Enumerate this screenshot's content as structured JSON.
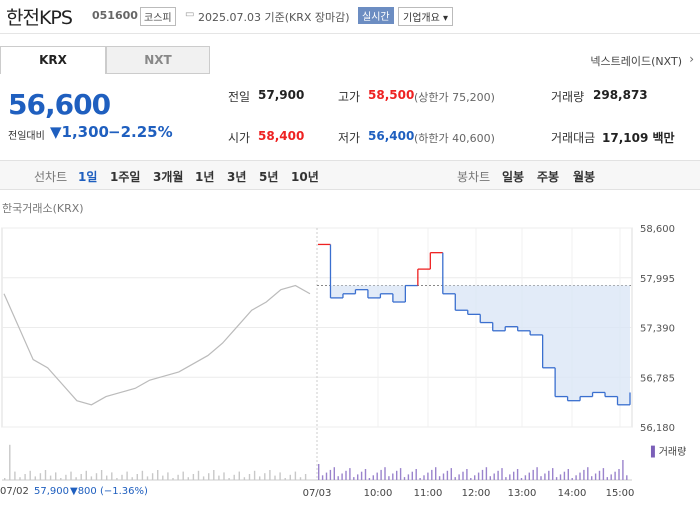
{
  "header": {
    "title": "한전KPS",
    "code": "051600",
    "market": "코스피",
    "date_text": "2025.07.03  기준(KRX 장마감)",
    "realtime_label": "실시간",
    "company_info_label": "기업개요 ▾"
  },
  "tabs": {
    "krx": "KRX",
    "nxt": "NXT",
    "nxt_link": "넥스트레이드(NXT)"
  },
  "quote": {
    "price": "56,600",
    "prev_label": "전일대비",
    "change": "▼1,300",
    "change_pct": "−2.25%",
    "prev_close_label": "전일",
    "prev_close": "57,900",
    "open_label": "시가",
    "open": "58,400",
    "high_label": "고가",
    "high": "58,500",
    "upper_limit": "(상한가 75,200)",
    "low_label": "저가",
    "low": "56,400",
    "lower_limit": "(하한가 40,600)",
    "volume_label": "거래량",
    "volume": "298,873",
    "amount_label": "거래대금",
    "amount": "17,109 백만"
  },
  "periods": {
    "line_label": "선차트",
    "items": [
      "1일",
      "1주일",
      "3개월",
      "1년",
      "3년",
      "5년",
      "10년"
    ],
    "candle_label": "봉차트",
    "candle_items": [
      "일봉",
      "주봉",
      "월봉"
    ]
  },
  "chart_source": "한국거래소(KRX)",
  "footer": {
    "prev_date": "07/02",
    "prev_price": "57,900",
    "prev_change": "▼800 (−1.36%)"
  },
  "volume_legend": "거래량",
  "chart_data": {
    "type": "line",
    "ylim": [
      56180,
      58600
    ],
    "y_ticks": [
      "58,600",
      "57,995",
      "57,390",
      "56,785",
      "56,180"
    ],
    "x_ticks": [
      "07/03",
      "10:00",
      "11:00",
      "12:00",
      "13:00",
      "14:00",
      "15:00"
    ],
    "reference_price": 57900,
    "series": [
      {
        "x": [
          "07/02",
          "",
          "",
          "",
          "",
          "",
          "",
          "",
          "",
          "",
          "",
          "",
          "",
          "",
          "",
          "",
          "",
          "",
          "",
          "",
          "",
          ""
        ],
        "values": [
          57800,
          57400,
          57000,
          56900,
          56700,
          56500,
          56450,
          56550,
          56600,
          56650,
          56750,
          56800,
          56850,
          56950,
          57050,
          57200,
          57400,
          57600,
          57700,
          57850,
          57900,
          57800
        ]
      },
      {
        "x": [
          "07/03",
          "",
          "",
          "",
          "10:00",
          "",
          "",
          "",
          "11:00",
          "",
          "",
          "",
          "12:00",
          "",
          "",
          "",
          "13:00",
          "",
          "",
          "",
          "14:00",
          "",
          "",
          "",
          "15:00",
          ""
        ],
        "values": [
          58400,
          57750,
          57800,
          57850,
          57750,
          57800,
          57700,
          57900,
          58100,
          58300,
          57800,
          57600,
          57550,
          57450,
          57350,
          57400,
          57350,
          57300,
          56900,
          56550,
          56500,
          56550,
          56600,
          56550,
          56450,
          56600
        ]
      }
    ]
  }
}
